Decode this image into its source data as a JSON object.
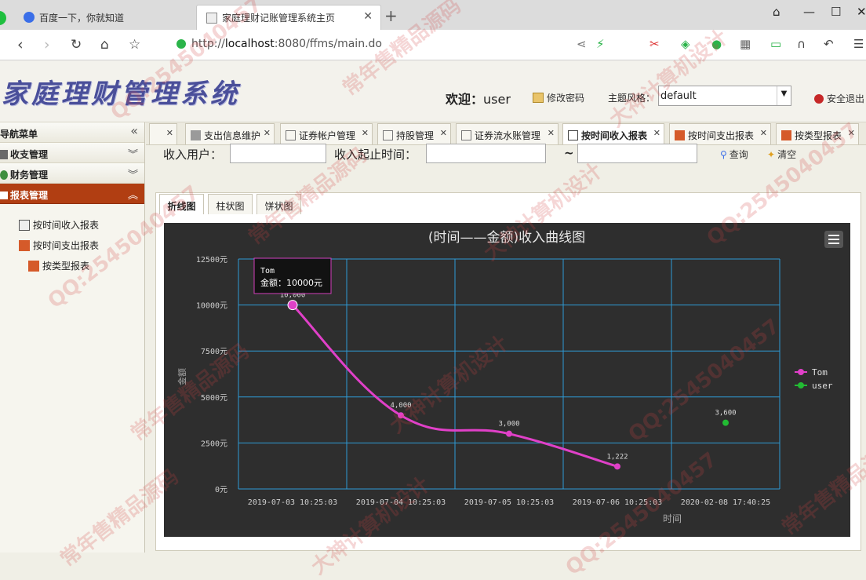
{
  "browser": {
    "tabs": [
      {
        "title": "百度一下，你就知道",
        "active": false
      },
      {
        "title": "家庭理财记账管理系统主页",
        "active": true
      }
    ],
    "new_tab": "+",
    "url_prefix": "http://",
    "url_host": "localhost",
    "url_rest": ":8080/ffms/main.do"
  },
  "header": {
    "logo": "家庭理财管理系统",
    "welcome_label": "欢迎：",
    "welcome_user": "user",
    "change_password": "修改密码",
    "theme_label": "主题风格：",
    "theme_value": "default",
    "logout": "安全退出"
  },
  "sidebar": {
    "title": "导航菜单",
    "groups": [
      {
        "label": "收支管理",
        "expanded": false
      },
      {
        "label": "财务管理",
        "expanded": false
      },
      {
        "label": "报表管理",
        "expanded": true
      }
    ],
    "items": [
      {
        "label": "按时间收入报表"
      },
      {
        "label": "按时间支出报表"
      },
      {
        "label": "按类型报表"
      }
    ]
  },
  "page_tabs": [
    {
      "label": ""
    },
    {
      "label": "支出信息维护"
    },
    {
      "label": "证券帐户管理"
    },
    {
      "label": "持股管理"
    },
    {
      "label": "证券流水账管理"
    },
    {
      "label": "按时间收入报表",
      "active": true
    },
    {
      "label": "按时间支出报表"
    },
    {
      "label": "按类型报表"
    }
  ],
  "search": {
    "user_label": "收入用户：",
    "user_value": "",
    "range_label": "收入起止时间：",
    "start_value": "",
    "sep": "~",
    "end_value": "",
    "query": "查询",
    "clear": "清空"
  },
  "chart_tabs": [
    {
      "label": "折线图",
      "active": true
    },
    {
      "label": "柱状图"
    },
    {
      "label": "饼状图"
    }
  ],
  "colors": {
    "chart_bg": "#2e2e2e",
    "grid": "#2f9bd6",
    "tom": "#e040c8",
    "user": "#22bb33",
    "sidebar_selected": "#b13e12"
  },
  "watermark": [
    "QQ:2545040457",
    "常年售精品源码",
    "大神计算机设计"
  ],
  "chart_data": {
    "type": "line",
    "title": "(时间——金额)收入曲线图",
    "xlabel": "时间",
    "ylabel": "金额",
    "categories": [
      "2019-07-03 10:25:03",
      "2019-07-04 10:25:03",
      "2019-07-05 10:25:03",
      "2019-07-06 10:25:03",
      "2020-02-08 17:40:25"
    ],
    "ylim": [
      0,
      12500
    ],
    "yticks": [
      {
        "value": 0,
        "label": "0元"
      },
      {
        "value": 2500,
        "label": "2500元"
      },
      {
        "value": 5000,
        "label": "5000元"
      },
      {
        "value": 7500,
        "label": "7500元"
      },
      {
        "value": 10000,
        "label": "10000元"
      },
      {
        "value": 12500,
        "label": "12500元"
      }
    ],
    "series": [
      {
        "name": "Tom",
        "values": [
          10000,
          4000,
          3000,
          1222,
          null
        ],
        "labels": [
          "10,000",
          "4,000",
          "3,000",
          "1,222",
          null
        ]
      },
      {
        "name": "user",
        "values": [
          null,
          null,
          null,
          null,
          3600
        ],
        "labels": [
          null,
          null,
          null,
          null,
          "3,600"
        ]
      }
    ],
    "grid": true,
    "legend": "right",
    "tooltip": {
      "series": "Tom",
      "line": "金额：10000元"
    }
  }
}
